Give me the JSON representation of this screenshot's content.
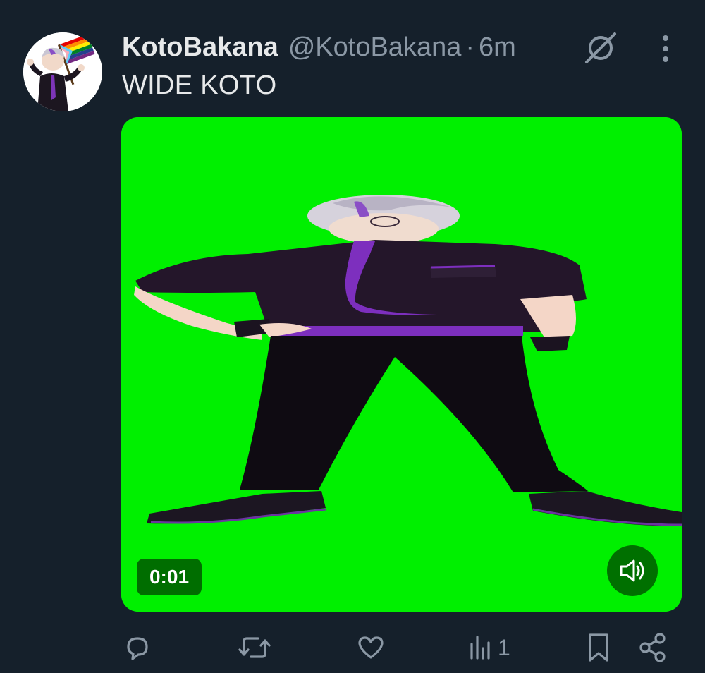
{
  "tweet": {
    "display_name": "KotoBakana",
    "handle": "@KotoBakana",
    "separator": "·",
    "time": "6m",
    "text": "WIDE KOTO"
  },
  "media": {
    "type": "video",
    "timestamp": "0:01",
    "background_color": "#00f000"
  },
  "actions": {
    "views": "1"
  },
  "icons": [
    "grok-icon",
    "more-icon",
    "volume-icon",
    "reply-icon",
    "retweet-icon",
    "like-icon",
    "views-icon",
    "bookmark-icon",
    "share-icon"
  ],
  "colors": {
    "background": "#15202b",
    "text": "#e7e9ea",
    "secondary": "#8b98a5"
  }
}
